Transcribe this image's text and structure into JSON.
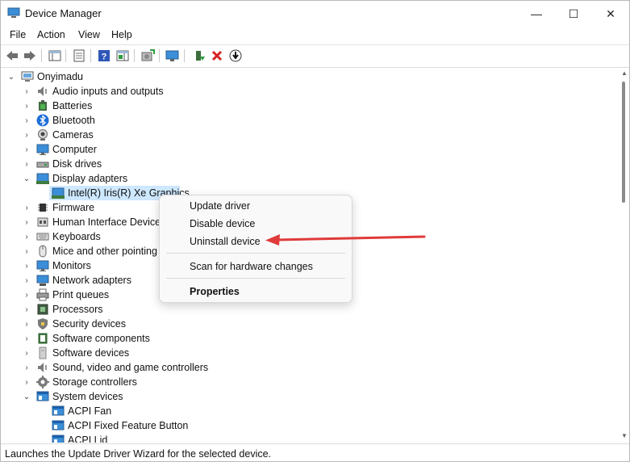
{
  "window": {
    "title": "Device Manager",
    "controls": [
      "—",
      "☐",
      "✕"
    ]
  },
  "menubar": [
    "File",
    "Action",
    "View",
    "Help"
  ],
  "toolbar": {
    "buttons": [
      "back-icon",
      "forward-icon",
      "show-hide-console-tree-icon",
      "properties-icon",
      "help-icon",
      "show-action-pane-icon",
      "update-driver-icon",
      "scan-hardware-icon",
      "enable-device-icon",
      "uninstall-device-icon",
      "download-driver-icon"
    ]
  },
  "tree": {
    "root": "Onyimadu",
    "items": [
      {
        "label": "Audio inputs and outputs",
        "icon": "speaker-icon",
        "expanded": false
      },
      {
        "label": "Batteries",
        "icon": "battery-icon",
        "expanded": false
      },
      {
        "label": "Bluetooth",
        "icon": "bluetooth-icon",
        "expanded": false
      },
      {
        "label": "Cameras",
        "icon": "camera-icon",
        "expanded": false
      },
      {
        "label": "Computer",
        "icon": "monitor-icon",
        "expanded": false
      },
      {
        "label": "Disk drives",
        "icon": "disk-drive-icon",
        "expanded": false
      },
      {
        "label": "Display adapters",
        "icon": "display-adapter-icon",
        "expanded": true
      },
      {
        "label": "Intel(R) Iris(R) Xe Graphics",
        "icon": "display-adapter-icon",
        "child": true,
        "selected": true
      },
      {
        "label": "Firmware",
        "icon": "chip-icon",
        "expanded": false
      },
      {
        "label": "Human Interface Devices",
        "icon": "hid-icon",
        "expanded": false
      },
      {
        "label": "Keyboards",
        "icon": "keyboard-icon",
        "expanded": false
      },
      {
        "label": "Mice and other pointing",
        "icon": "mouse-icon",
        "expanded": false
      },
      {
        "label": "Monitors",
        "icon": "monitor-icon",
        "expanded": false
      },
      {
        "label": "Network adapters",
        "icon": "network-icon",
        "expanded": false
      },
      {
        "label": "Print queues",
        "icon": "printer-icon",
        "expanded": false
      },
      {
        "label": "Processors",
        "icon": "processor-icon",
        "expanded": false
      },
      {
        "label": "Security devices",
        "icon": "security-icon",
        "expanded": false
      },
      {
        "label": "Software components",
        "icon": "software-component-icon",
        "expanded": false
      },
      {
        "label": "Software devices",
        "icon": "software-device-icon",
        "expanded": false
      },
      {
        "label": "Sound, video and game controllers",
        "icon": "speaker-icon",
        "expanded": false
      },
      {
        "label": "Storage controllers",
        "icon": "storage-controller-icon",
        "expanded": false
      },
      {
        "label": "System devices",
        "icon": "system-device-icon",
        "expanded": true
      },
      {
        "label": "ACPI Fan",
        "icon": "system-device-icon",
        "child": true
      },
      {
        "label": "ACPI Fixed Feature Button",
        "icon": "system-device-icon",
        "child": true
      },
      {
        "label": "ACPI Lid",
        "icon": "system-device-icon",
        "child": true
      }
    ]
  },
  "context_menu": {
    "items": [
      {
        "label": "Update driver",
        "bold": false
      },
      {
        "label": "Disable device",
        "bold": false
      },
      {
        "label": "Uninstall device",
        "bold": false
      },
      {
        "separator": true
      },
      {
        "label": "Scan for hardware changes",
        "bold": false
      },
      {
        "separator": true
      },
      {
        "label": "Properties",
        "bold": true
      }
    ]
  },
  "annotation": {
    "type": "arrow",
    "color": "#e03a3a",
    "points_to": "Uninstall device"
  },
  "statusbar": {
    "text": "Launches the Update Driver Wizard for the selected device."
  },
  "colors": {
    "selection": "#cde8ff",
    "arrow": "#e03a3a",
    "folder_blue": "#1e88e5"
  }
}
